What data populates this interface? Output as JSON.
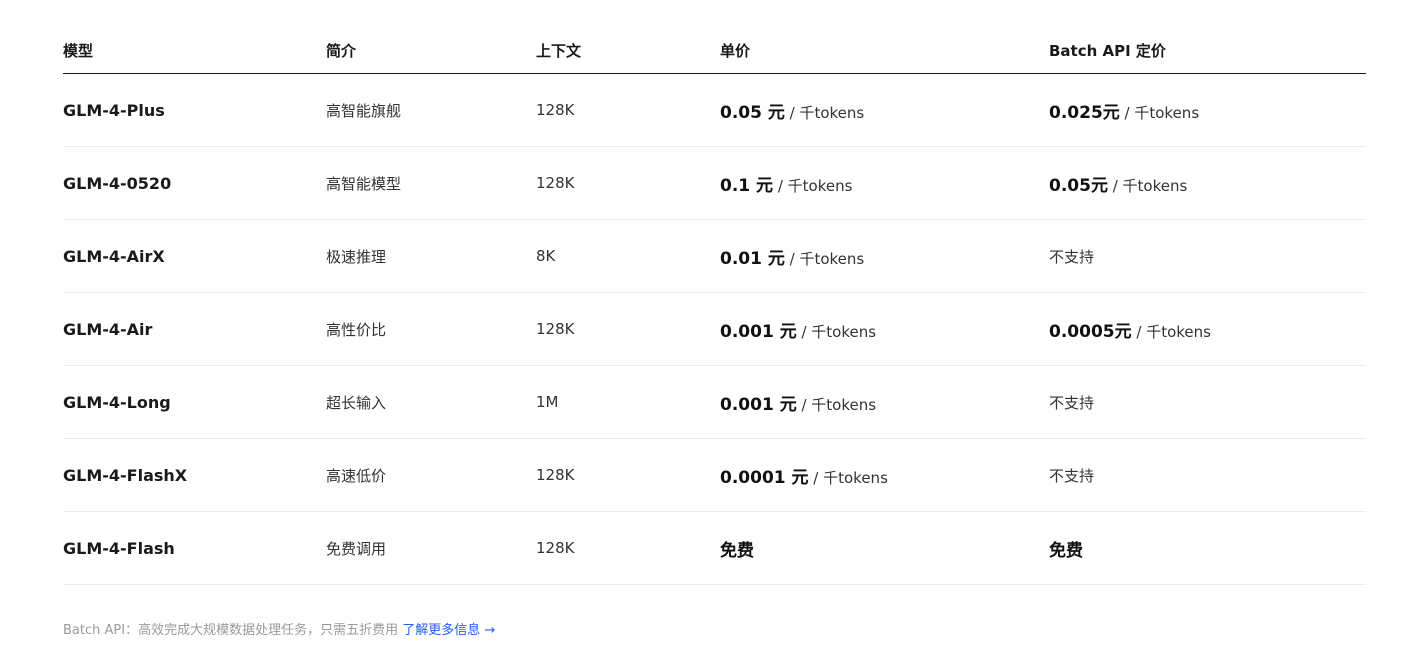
{
  "table": {
    "headers": [
      "模型",
      "简介",
      "上下文",
      "单价",
      "Batch API 定价"
    ],
    "rows": [
      {
        "model": "GLM-4-Plus",
        "desc": "高智能旗舰",
        "context": "128K",
        "price_value": "0.05 元",
        "price_unit": " / 千tokens",
        "batch_value": "0.025元",
        "batch_unit": " / 千tokens"
      },
      {
        "model": "GLM-4-0520",
        "desc": "高智能模型",
        "context": "128K",
        "price_value": "0.1 元",
        "price_unit": " / 千tokens",
        "batch_value": "0.05元",
        "batch_unit": " / 千tokens"
      },
      {
        "model": "GLM-4-AirX",
        "desc": "极速推理",
        "context": "8K",
        "price_value": "0.01 元",
        "price_unit": " / 千tokens",
        "batch_value": "",
        "batch_unit": "",
        "batch_plain": "不支持"
      },
      {
        "model": "GLM-4-Air",
        "desc": "高性价比",
        "context": "128K",
        "price_value": "0.001 元",
        "price_unit": " / 千tokens",
        "batch_value": "0.0005元",
        "batch_unit": " / 千tokens"
      },
      {
        "model": "GLM-4-Long",
        "desc": "超长输入",
        "context": "1M",
        "price_value": "0.001 元",
        "price_unit": " / 千tokens",
        "batch_value": "",
        "batch_unit": "",
        "batch_plain": "不支持"
      },
      {
        "model": "GLM-4-FlashX",
        "desc": "高速低价",
        "context": "128K",
        "price_value": "0.0001 元",
        "price_unit": " / 千tokens",
        "batch_value": "",
        "batch_unit": "",
        "batch_plain": "不支持"
      },
      {
        "model": "GLM-4-Flash",
        "desc": "免费调用",
        "context": "128K",
        "price_value": "免费",
        "price_unit": "",
        "batch_value": "免费",
        "batch_unit": ""
      }
    ]
  },
  "footer": {
    "text": "Batch API：高效完成大规模数据处理任务，只需五折费用 ",
    "link_label": "了解更多信息 →"
  },
  "colors": {
    "link": "#1f5bff",
    "footer_text": "#9a9a9a",
    "divider": "#ececec",
    "header_rule": "#1a1a1a"
  }
}
